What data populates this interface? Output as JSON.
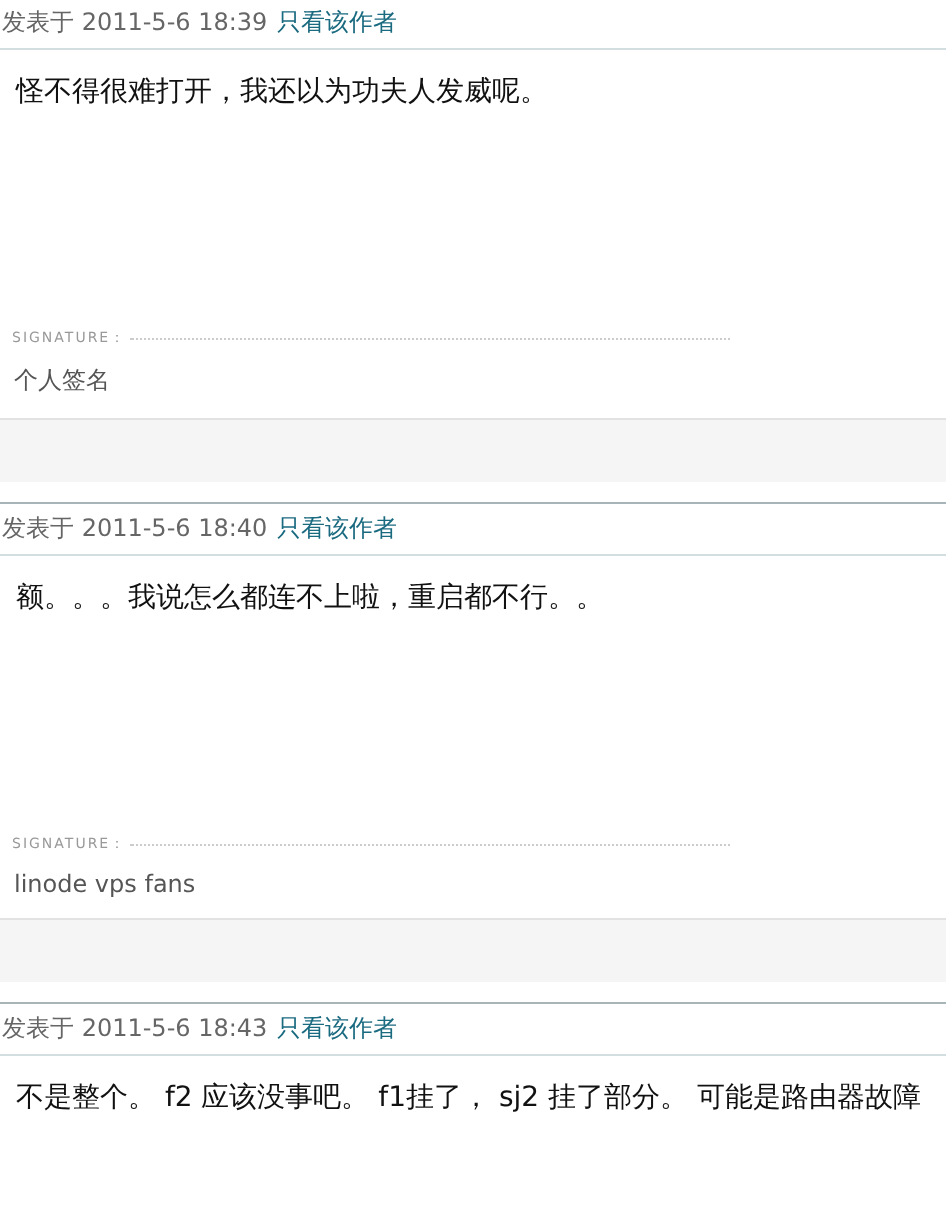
{
  "posts": [
    {
      "posted": "发表于 2011-5-6 18:39",
      "author_link": "只看该作者",
      "body": "怪不得很难打开，我还以为功夫人发威呢。",
      "signature_label": "SIGNATURE：",
      "signature": "个人签名"
    },
    {
      "posted": "发表于 2011-5-6 18:40",
      "author_link": "只看该作者",
      "body": "额。。。我说怎么都连不上啦，重启都不行。。",
      "signature_label": "SIGNATURE：",
      "signature": "linode vps fans"
    },
    {
      "posted": "发表于 2011-5-6 18:43",
      "author_link": "只看该作者",
      "body": "不是整个。 f2 应该没事吧。 f1挂了， sj2 挂了部分。 可能是路由器故障"
    }
  ]
}
